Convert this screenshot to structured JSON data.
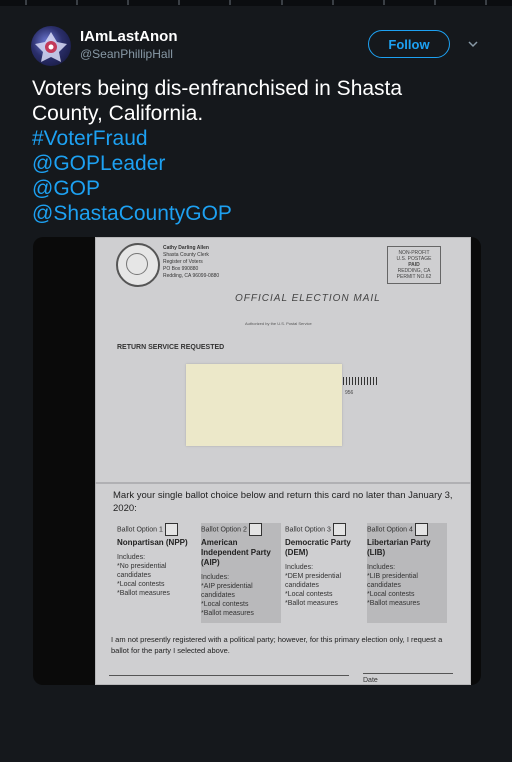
{
  "tweet": {
    "display_name": "IAmLastAnon",
    "handle": "@SeanPhillipHall",
    "follow_label": "Follow",
    "text_line1": "Voters being dis-enfranchised in Shasta",
    "text_line2": "County, California.",
    "hashtags": [
      "#VoterFraud",
      "@GOPLeader",
      "@GOP",
      "@ShastaCountyGOP"
    ]
  },
  "photo": {
    "sender": [
      "Cathy Darling Allen",
      "Shasta County Clerk",
      "Register of Voters",
      "PO Box 990880",
      "Redding, CA 96099-0880"
    ],
    "stamp": [
      "NON-PROFIT",
      "U.S. POSTAGE",
      "PAID",
      "REDDING, CA",
      "PERMIT NO.62"
    ],
    "emblem": "OFFICIAL ELECTION MAIL",
    "emblem_sub": "Authorized by the U.S. Postal Service",
    "return_service": "RETURN SERVICE REQUESTED",
    "barcode_number": "956",
    "instruction": "Mark your single ballot choice below and return this card no later than January 3, 2020:",
    "options": [
      {
        "header": "Ballot Option 1",
        "party": "Nonpartisan (NPP)",
        "includes": "Includes:",
        "items": [
          "*No presidential candidates",
          "*Local contests",
          "*Ballot measures"
        ]
      },
      {
        "header": "Ballot Option 2",
        "party": "American Independent Party (AIP)",
        "includes": "Includes:",
        "items": [
          "*AIP presidential candidates",
          "*Local contests",
          "*Ballot measures"
        ]
      },
      {
        "header": "Ballot Option 3",
        "party": "Democratic Party (DEM)",
        "includes": "Includes:",
        "items": [
          "*DEM presidential candidates",
          "*Local contests",
          "*Ballot measures"
        ]
      },
      {
        "header": "Ballot Option 4",
        "party": "Libertarian Party (LIB)",
        "includes": "Includes:",
        "items": [
          "*LIB presidential candidates",
          "*Local contests",
          "*Ballot measures"
        ]
      }
    ],
    "declaration": "I am not presently registered with a political party; however, for this primary election only, I request a ballot for the party I selected above.",
    "date_label": "Date"
  },
  "colors": {
    "background": "#15181c",
    "accent": "#1da1f2",
    "secondary_text": "#8899a6"
  },
  "icons": {
    "more": "chevron-down-icon"
  }
}
